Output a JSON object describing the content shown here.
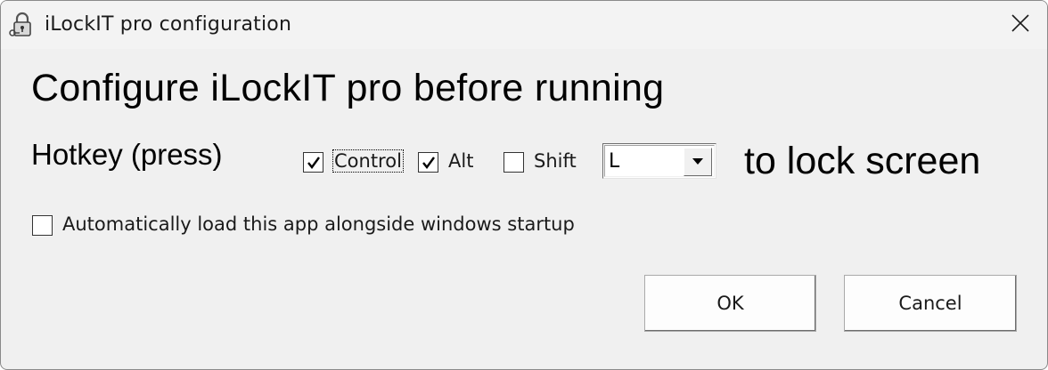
{
  "window": {
    "title": "iLockIT pro configuration",
    "icon": "padlock-icon",
    "close_icon": "close-icon"
  },
  "main": {
    "heading": "Configure iLockIT pro before running",
    "hotkey_label": "Hotkey (press)",
    "modifiers": [
      {
        "label": "Control",
        "checked": true,
        "focused": true
      },
      {
        "label": "Alt",
        "checked": true,
        "focused": false
      },
      {
        "label": "Shift",
        "checked": false,
        "focused": false
      }
    ],
    "key_select": {
      "value": "L"
    },
    "suffix": "to lock screen",
    "startup": {
      "label": "Automatically load this app alongside windows startup",
      "checked": false
    }
  },
  "buttons": {
    "ok_label": "OK",
    "cancel_label": "Cancel"
  }
}
